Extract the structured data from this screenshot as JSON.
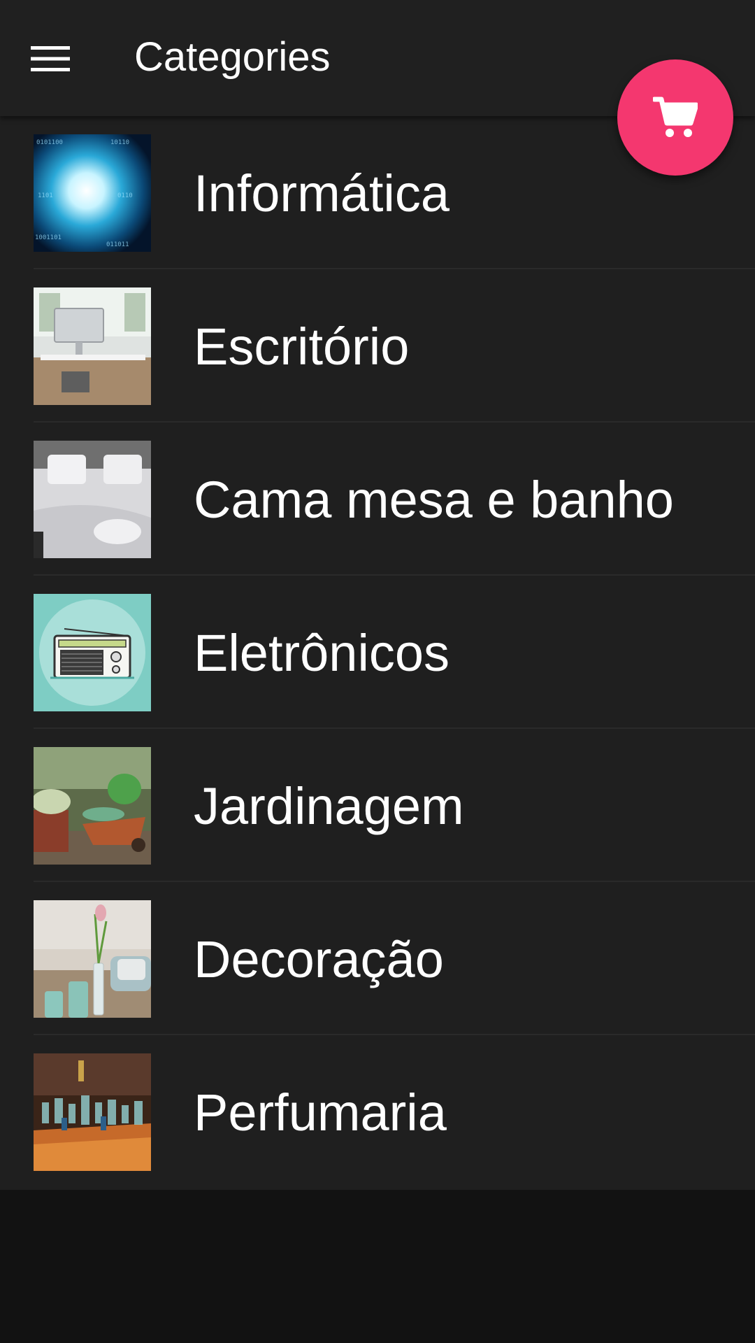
{
  "app_bar": {
    "title": "Categories",
    "menu_icon": "hamburger-menu-icon",
    "background": "#202020"
  },
  "fab": {
    "icon": "shopping-cart-icon",
    "color": "#f4376f"
  },
  "categories": [
    {
      "label": "Informática",
      "image": "binary-tunnel-image"
    },
    {
      "label": "Escritório",
      "image": "office-desk-image"
    },
    {
      "label": "Cama mesa e banho",
      "image": "bed-linen-image"
    },
    {
      "label": "Eletrônicos",
      "image": "radio-image"
    },
    {
      "label": "Jardinagem",
      "image": "garden-wheelbarrow-image"
    },
    {
      "label": "Decoração",
      "image": "decor-vase-image"
    },
    {
      "label": "Perfumaria",
      "image": "perfume-bottles-image"
    }
  ]
}
